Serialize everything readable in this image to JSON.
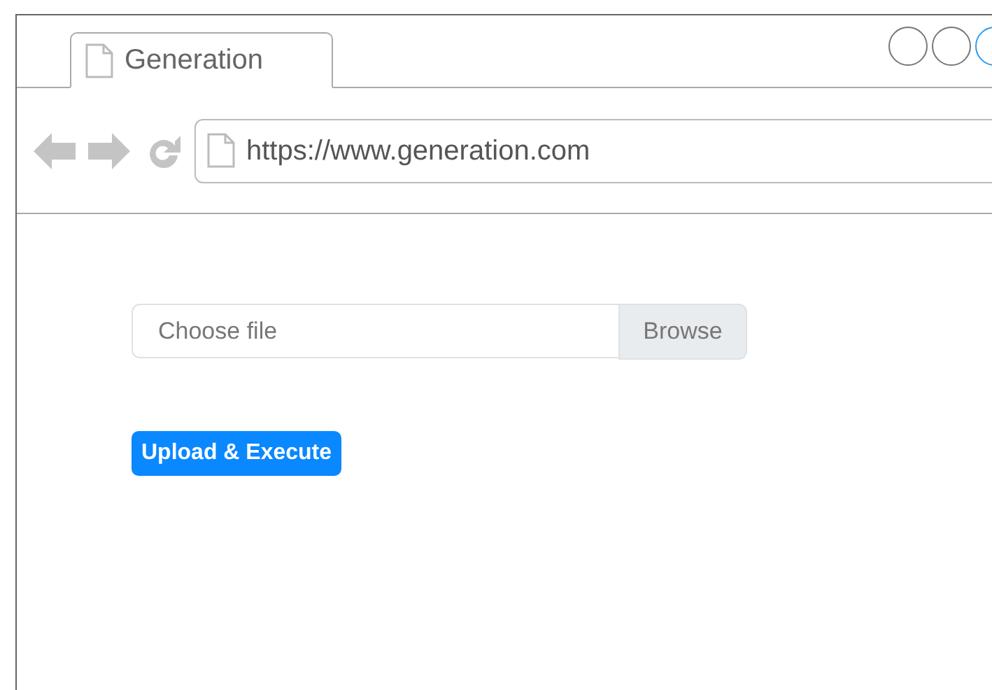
{
  "tabs": [
    {
      "label": "Generation",
      "selected": true
    }
  ],
  "address_bar": {
    "url": "https://www.generation.com"
  },
  "file_picker": {
    "placeholder": "Choose file",
    "button": "Browse"
  },
  "buttons": [
    "Upload & Execute"
  ]
}
